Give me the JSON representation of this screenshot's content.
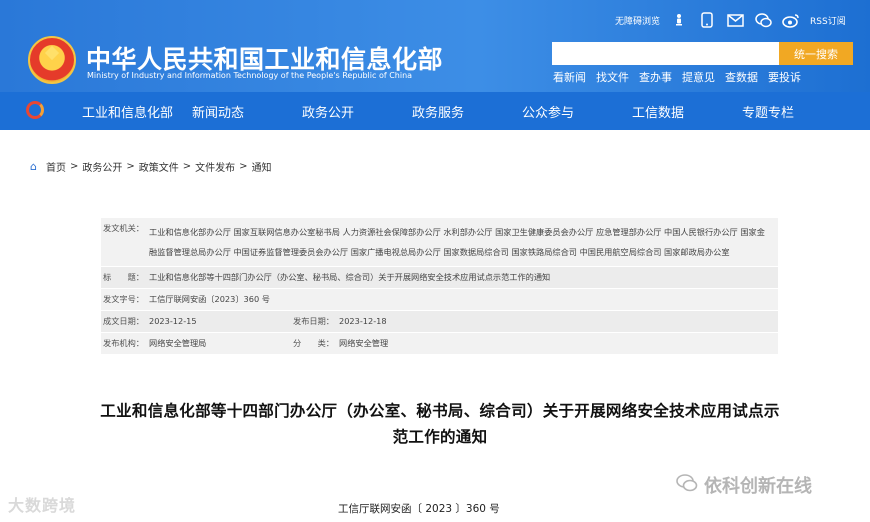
{
  "header": {
    "title": "中华人民共和国工业和信息化部",
    "subtitle": "Ministry of Industry and Information Technology of the People's Republic of China",
    "top_links": {
      "accessibility": "无障碍浏览",
      "rss": "RSS订阅"
    },
    "search": {
      "placeholder": "",
      "button": "统一搜索"
    },
    "quick_links": [
      "看新闻",
      "找文件",
      "查办事",
      "提意见",
      "查数据",
      "要投诉"
    ]
  },
  "nav": {
    "items": [
      "工业和信息化部",
      "新闻动态",
      "政务公开",
      "政务服务",
      "公众参与",
      "工信数据",
      "专题专栏"
    ]
  },
  "breadcrumb": {
    "items": [
      "首页",
      "政务公开",
      "政策文件",
      "文件发布",
      "通知"
    ]
  },
  "meta": {
    "issuer_label": "发文机关：",
    "issuer": "工业和信息化部办公厅 国家互联网信息办公室秘书局 人力资源社会保障部办公厅 水利部办公厅 国家卫生健康委员会办公厅 应急管理部办公厅 中国人民银行办公厅 国家金融监督管理总局办公厅 中国证券监督管理委员会办公厅 国家广播电视总局办公厅 国家数据局综合司 国家铁路局综合司 中国民用航空局综合司 国家邮政局办公室",
    "title_label": "标　　题：",
    "title": "工业和信息化部等十四部门办公厅（办公室、秘书局、综合司）关于开展网络安全技术应用试点示范工作的通知",
    "doc_number_label": "发文字号：",
    "doc_number": "工信厅联网安函〔2023〕360 号",
    "created_label": "成文日期：",
    "created": "2023-12-15",
    "published_label": "发布日期：",
    "published": "2023-12-18",
    "publisher_label": "发布机构：",
    "publisher": "网络安全管理局",
    "category_label": "分　　类：",
    "category": "网络安全管理"
  },
  "document": {
    "title": "工业和信息化部等十四部门办公厅（办公室、秘书局、综合司）关于开展网络安全技术应用试点示范工作的通知",
    "number": "工信厅联网安函〔 2023 〕360 号"
  },
  "watermarks": {
    "left": "大数跨境",
    "right": "依科创新在线"
  }
}
